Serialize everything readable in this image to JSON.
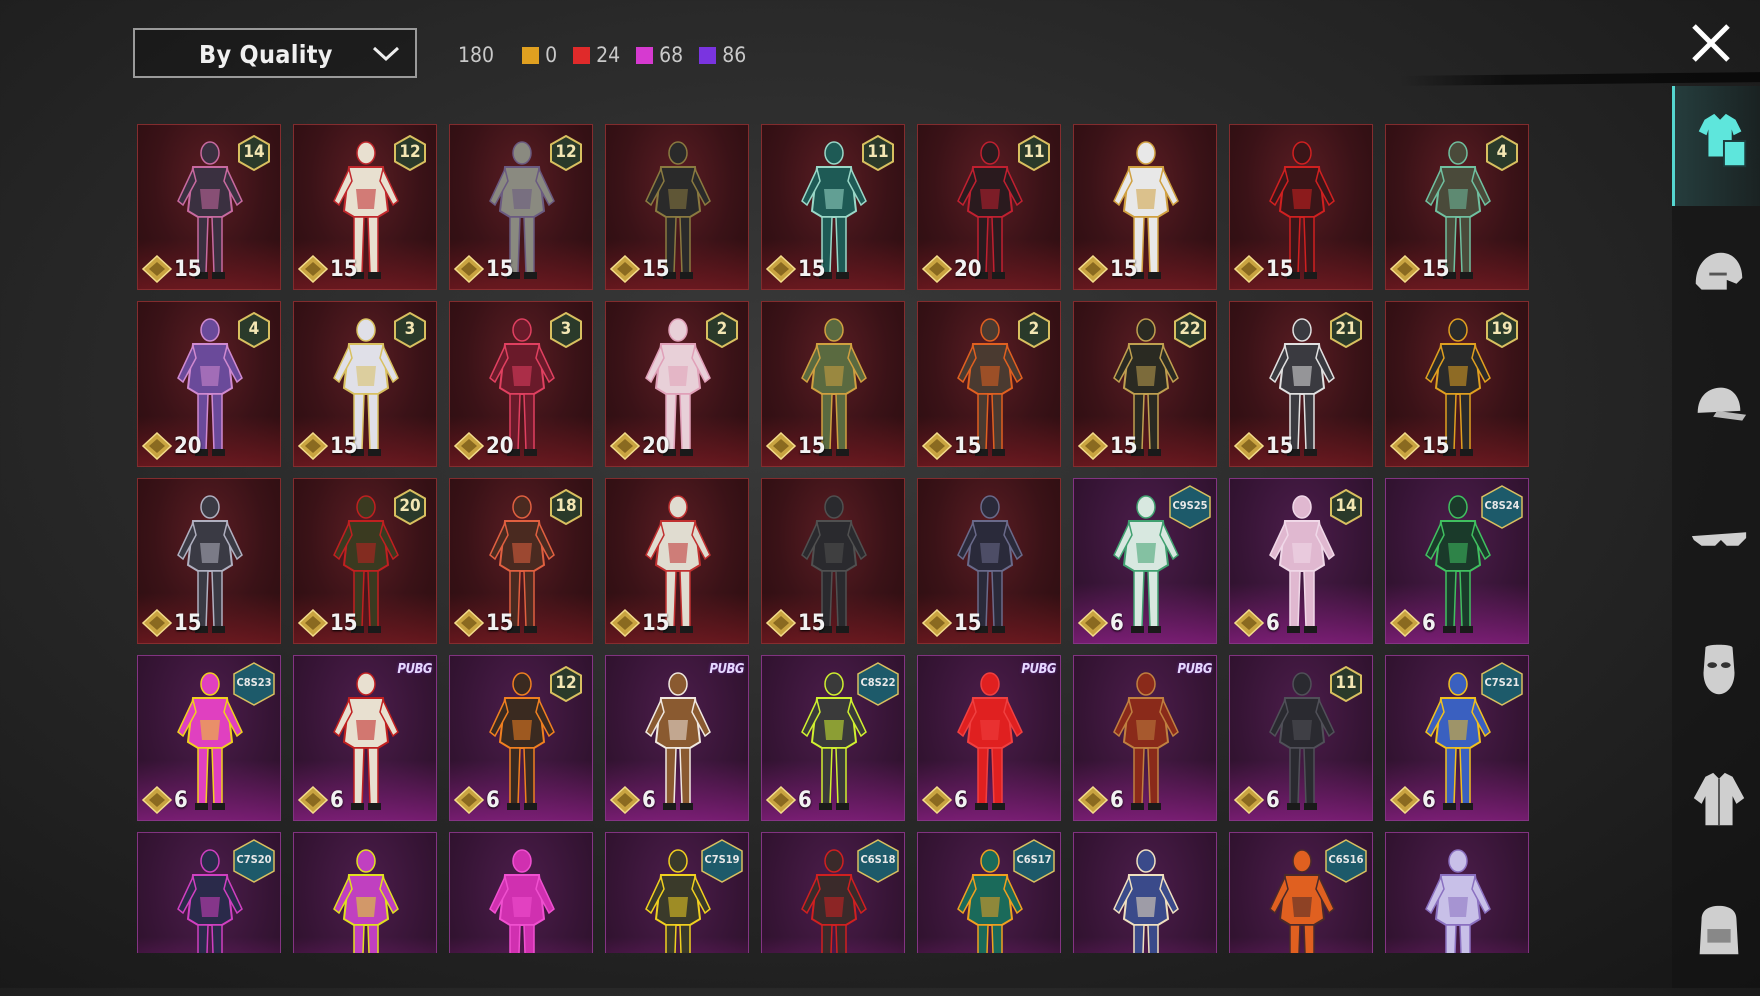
{
  "sort": {
    "label": "By Quality"
  },
  "counts": {
    "total": "180",
    "items": [
      {
        "color": "#e0a020",
        "value": "0"
      },
      {
        "color": "#e02a2a",
        "value": "24"
      },
      {
        "color": "#d63ad0",
        "value": "68"
      },
      {
        "color": "#7a34e0",
        "value": "86"
      }
    ]
  },
  "cards": [
    {
      "q": "red",
      "cost": "15",
      "badge": "14",
      "fig": "#3a3040",
      "acc": "#c86aa0"
    },
    {
      "q": "red",
      "cost": "15",
      "badge": "12",
      "fig": "#e8e0d0",
      "acc": "#c0282c"
    },
    {
      "q": "red",
      "cost": "15",
      "badge": "12",
      "fig": "#8a8a80",
      "acc": "#6a5a80"
    },
    {
      "q": "red",
      "cost": "15",
      "badge": "",
      "fig": "#2a2a2a",
      "acc": "#8a7a40"
    },
    {
      "q": "red",
      "cost": "15",
      "badge": "11",
      "fig": "#1e5a55",
      "acc": "#9ad8c8"
    },
    {
      "q": "red",
      "cost": "20",
      "badge": "11",
      "fig": "#2a1a1e",
      "acc": "#c02030"
    },
    {
      "q": "red",
      "cost": "15",
      "badge": "",
      "fig": "#e8e8e8",
      "acc": "#d0a040"
    },
    {
      "q": "red",
      "cost": "15",
      "badge": "",
      "fig": "#3a1518",
      "acc": "#d02020"
    },
    {
      "q": "red",
      "cost": "15",
      "badge": "4",
      "fig": "#4a4a3a",
      "acc": "#70c0a0"
    },
    {
      "q": "red",
      "cost": "20",
      "badge": "4",
      "fig": "#6a4a9a",
      "acc": "#d08ad0"
    },
    {
      "q": "red",
      "cost": "15",
      "badge": "3",
      "fig": "#e0e0e8",
      "acc": "#d8c060"
    },
    {
      "q": "red",
      "cost": "20",
      "badge": "3",
      "fig": "#6a1a2a",
      "acc": "#e04060"
    },
    {
      "q": "red",
      "cost": "20",
      "badge": "2",
      "fig": "#e8d0d8",
      "acc": "#e0a0b8"
    },
    {
      "q": "red",
      "cost": "15",
      "badge": "",
      "fig": "#5a6a40",
      "acc": "#d0a040"
    },
    {
      "q": "red",
      "cost": "15",
      "badge": "2",
      "fig": "#4a3a30",
      "acc": "#e06020"
    },
    {
      "q": "red",
      "cost": "15",
      "badge": "22",
      "fig": "#2a2a22",
      "acc": "#c0a050"
    },
    {
      "q": "red",
      "cost": "15",
      "badge": "21",
      "fig": "#3a3a40",
      "acc": "#e0e0e0"
    },
    {
      "q": "red",
      "cost": "15",
      "badge": "19",
      "fig": "#2a2a2a",
      "acc": "#e0a020"
    },
    {
      "q": "red",
      "cost": "15",
      "badge": "",
      "fig": "#3a3a44",
      "acc": "#b0b0c0"
    },
    {
      "q": "red",
      "cost": "15",
      "badge": "20",
      "fig": "#3a3a20",
      "acc": "#c02020"
    },
    {
      "q": "red",
      "cost": "15",
      "badge": "18",
      "fig": "#4a2a20",
      "acc": "#e06040"
    },
    {
      "q": "red",
      "cost": "15",
      "badge": "",
      "fig": "#e0dcd0",
      "acc": "#c03030"
    },
    {
      "q": "red",
      "cost": "15",
      "badge": "",
      "fig": "#2a2a2e",
      "acc": "#505050"
    },
    {
      "q": "red",
      "cost": "15",
      "badge": "",
      "fig": "#2a2a3a",
      "acc": "#6a6a8a"
    },
    {
      "q": "purple",
      "cost": "6",
      "season": "C9S25",
      "fig": "#d8e8e0",
      "acc": "#40a070"
    },
    {
      "q": "purple",
      "cost": "6",
      "badge": "14",
      "fig": "#e0b8d0",
      "acc": "#f0d8e8"
    },
    {
      "q": "purple",
      "cost": "6",
      "season": "C8S24",
      "fig": "#1a3a2a",
      "acc": "#40c060"
    },
    {
      "q": "purple",
      "cost": "6",
      "season": "C8S23",
      "fig": "#e040c0",
      "acc": "#f0d020"
    },
    {
      "q": "purple",
      "cost": "6",
      "pubg": "PUBG",
      "fig": "#e8e0d0",
      "acc": "#c02020"
    },
    {
      "q": "purple",
      "cost": "6",
      "badge": "12",
      "fig": "#3a2a20",
      "acc": "#f08020"
    },
    {
      "q": "purple",
      "cost": "6",
      "pubg": "PUBG",
      "fig": "#8a5a30",
      "acc": "#f0e8e0"
    },
    {
      "q": "purple",
      "cost": "6",
      "season": "C8S22",
      "fig": "#3a3a3a",
      "acc": "#d0f030"
    },
    {
      "q": "purple",
      "cost": "6",
      "pubg": "PUBG",
      "fig": "#e02020",
      "acc": "#f04040"
    },
    {
      "q": "purple",
      "cost": "6",
      "pubg": "PUBG",
      "fig": "#8a2a1a",
      "acc": "#c08040"
    },
    {
      "q": "purple",
      "cost": "6",
      "badge": "11",
      "fig": "#2a2a30",
      "acc": "#505058"
    },
    {
      "q": "purple",
      "cost": "6",
      "season": "C7S21",
      "fig": "#3a60c0",
      "acc": "#f0c020"
    },
    {
      "q": "purple",
      "cost": "",
      "season": "C7S20",
      "fig": "#2a2a4a",
      "acc": "#d040c0"
    },
    {
      "q": "purple",
      "cost": "",
      "badge": "",
      "fig": "#c040c0",
      "acc": "#e0e020"
    },
    {
      "q": "purple",
      "cost": "",
      "badge": "",
      "fig": "#d030b0",
      "acc": "#f050d0"
    },
    {
      "q": "purple",
      "cost": "",
      "season": "C7S19",
      "fig": "#3a3a2a",
      "acc": "#f0d020"
    },
    {
      "q": "purple",
      "cost": "",
      "season": "C6S18",
      "fig": "#3a2a2a",
      "acc": "#d02020"
    },
    {
      "q": "purple",
      "cost": "",
      "season": "C6S17",
      "fig": "#1a6a5a",
      "acc": "#f0a020"
    },
    {
      "q": "purple",
      "cost": "",
      "badge": "",
      "fig": "#3a4a8a",
      "acc": "#f0e0c0"
    },
    {
      "q": "purple",
      "cost": "",
      "season": "C6S16",
      "fig": "#e06020",
      "acc": "#4a2a2a"
    },
    {
      "q": "purple",
      "cost": "",
      "badge": "",
      "fig": "#c8c0e8",
      "acc": "#8a70c0"
    }
  ],
  "sidebar": [
    "outfit-icon",
    "helmet-icon",
    "cap-icon",
    "goggles-icon",
    "mask-icon",
    "jacket-icon",
    "backpack-icon"
  ]
}
